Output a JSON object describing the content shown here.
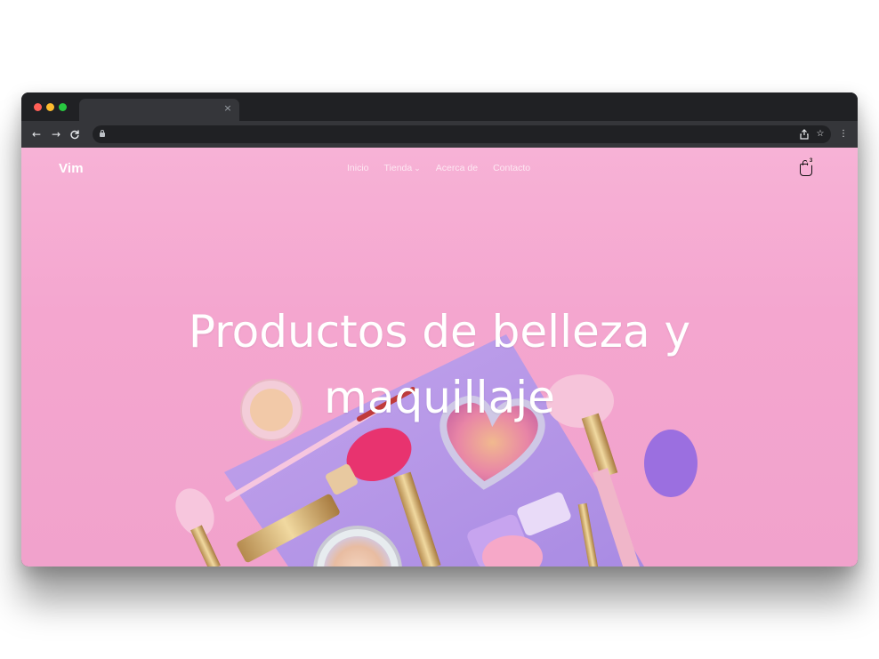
{
  "browser": {
    "tab_close_glyph": "×",
    "nav": {
      "back": "←",
      "forward": "→",
      "reload": "C"
    },
    "right_icons": [
      "share-icon",
      "star-icon",
      "menu-icon"
    ]
  },
  "site": {
    "brand": "Vim",
    "nav": [
      {
        "label": "Inicio"
      },
      {
        "label": "Tienda",
        "has_dropdown": true
      },
      {
        "label": "Acerca de"
      },
      {
        "label": "Contacto"
      }
    ],
    "cart_count": "3"
  },
  "hero": {
    "title_line1": "Productos de belleza y",
    "title_line2": "maquillaje"
  },
  "colors": {
    "hero_bg": "#f4a6cf",
    "accent_purple": "#b9a0ec",
    "sponge_pink": "#e8336f",
    "sponge_purple": "#9b6fe0"
  }
}
